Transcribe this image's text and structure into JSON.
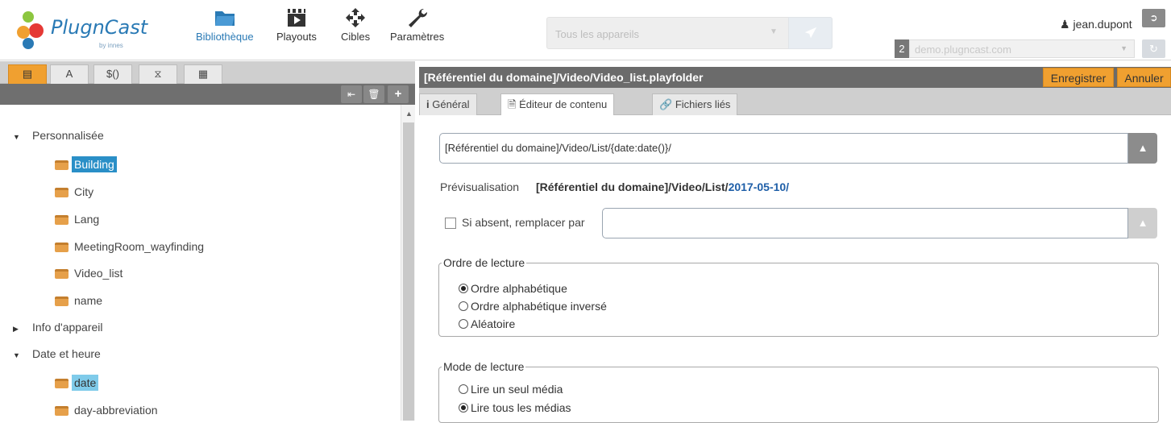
{
  "brand": {
    "name": "PlugnCast",
    "sub": "by innes"
  },
  "nav": [
    {
      "label": "Bibliothèque",
      "icon": "folder-icon",
      "active": true
    },
    {
      "label": "Playouts",
      "icon": "playouts-icon"
    },
    {
      "label": "Cibles",
      "icon": "target-icon"
    },
    {
      "label": "Paramètres",
      "icon": "wrench-icon"
    }
  ],
  "search": {
    "placeholder": "Tous les appareils"
  },
  "user": {
    "name": "jean.dupont"
  },
  "server": {
    "number": "2",
    "domain": "demo.plugncast.com"
  },
  "left": {
    "tabs": [
      {
        "label": "",
        "icon": "drawer-icon",
        "active": true
      },
      {
        "label": "A",
        "icon": ""
      },
      {
        "label": "$()",
        "icon": ""
      },
      {
        "label": "",
        "icon": "tag-icon"
      },
      {
        "label": "",
        "icon": "calendar-icon"
      }
    ],
    "tree": {
      "cat1": "Personnalisée",
      "items1": [
        "Building",
        "City",
        "Lang",
        "MeetingRoom_wayfinding",
        "Video_list",
        "name"
      ],
      "cat2": "Info d'appareil",
      "cat3": "Date et heure",
      "items3": [
        "date",
        "day-abbreviation"
      ]
    }
  },
  "right": {
    "title": "[Référentiel du domaine]/Video/Video_list.playfolder",
    "save": "Enregistrer",
    "cancel": "Annuler",
    "tabs": {
      "general": "Général",
      "editor": "Éditeur de contenu",
      "files": "Fichiers liés"
    },
    "path_value": "[Référentiel du domaine]/Video/List/{date:date()}/",
    "preview_label": "Prévisualisation",
    "preview_prefix": "[Référentiel du domaine]/Video/List/",
    "preview_date": "2017-05-10/",
    "fallback_label": "Si absent, remplacer par",
    "order": {
      "legend": "Ordre de lecture",
      "options": [
        "Ordre alphabétique",
        "Ordre alphabétique inversé",
        "Aléatoire"
      ],
      "selected": 0
    },
    "mode": {
      "legend": "Mode de lecture",
      "options": [
        "Lire un seul média",
        "Lire tous les médias"
      ],
      "selected": 1
    }
  },
  "colors": {
    "accent": "#f0a030",
    "brand": "#2a7ab5",
    "selection": "#2a8fc7"
  }
}
